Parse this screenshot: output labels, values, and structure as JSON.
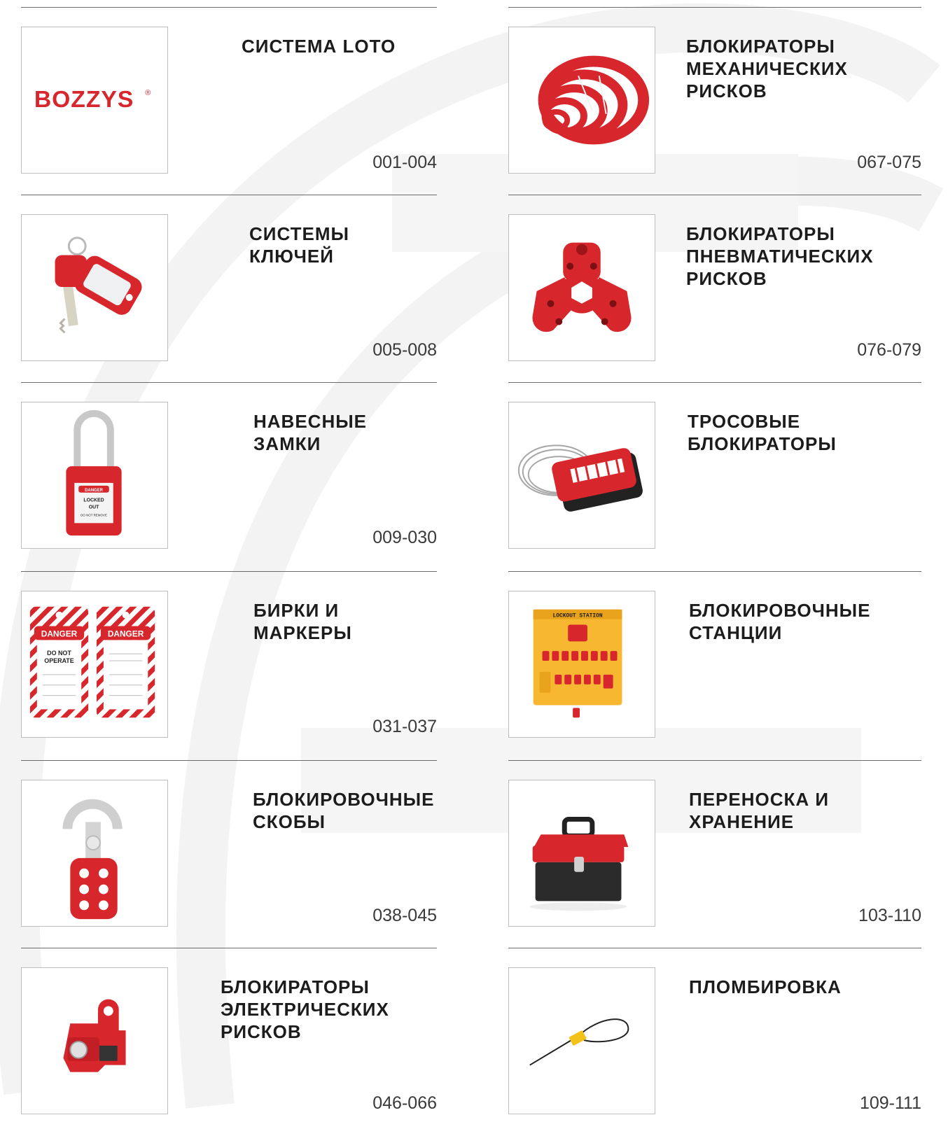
{
  "brand": {
    "logo_text": "BOZZYS",
    "registered_mark": "®"
  },
  "left_column": [
    {
      "title": "СИСТЕМА LOTO",
      "pages": "001-004",
      "icon": "bozzys-logo"
    },
    {
      "title": "СИСТЕМЫ КЛЮЧЕЙ",
      "pages": "005-008",
      "icon": "key-with-tag-icon"
    },
    {
      "title": "НАВЕСНЫЕ ЗАМКИ",
      "pages": "009-030",
      "icon": "padlock-icon"
    },
    {
      "title": "БИРКИ И МАРКЕРЫ",
      "pages": "031-037",
      "icon": "danger-tags-icon"
    },
    {
      "title": "БЛОКИРОВОЧНЫЕ\nСКОБЫ",
      "pages": "038-045",
      "icon": "lockout-hasp-icon"
    },
    {
      "title": "БЛОКИРАТОРЫ\nЭЛЕКТРИЧЕСКИХ\nРИСКОВ",
      "pages": "046-066",
      "icon": "breaker-lockout-icon"
    }
  ],
  "right_column": [
    {
      "title": "БЛОКИРАТОРЫ\nМЕХАНИЧЕСКИХ\nРИСКОВ",
      "pages": "067-075",
      "icon": "valve-lockouts-icon"
    },
    {
      "title": "БЛОКИРАТОРЫ\nПНЕВМАТИЧЕСКИХ\nРИСКОВ",
      "pages": "076-079",
      "icon": "pneumatic-lockout-icon"
    },
    {
      "title": "ТРОСОВЫЕ\nБЛОКИРАТОРЫ",
      "pages": "",
      "icon": "cable-lockout-icon"
    },
    {
      "title": "БЛОКИРОВОЧНЫЕ\nСТАНЦИИ",
      "pages": "",
      "icon": "lockout-station-icon"
    },
    {
      "title": "ПЕРЕНОСКА И\nХРАНЕНИЕ",
      "pages": "103-110",
      "icon": "toolbox-icon"
    },
    {
      "title": "ПЛОМБИРОВКА",
      "pages": "109-111",
      "icon": "cable-seal-icon"
    }
  ],
  "images": {
    "padlock_label": [
      "DANGER",
      "LOCKED",
      "OUT",
      "DO NOT REMOVE"
    ],
    "tag_label": "DANGER",
    "tag_text": [
      "DO NOT",
      "OPERATE"
    ],
    "station_label": "LOCKOUT STATION"
  },
  "colors": {
    "accent": "#d7262c",
    "text": "#1c1c1c",
    "pages_text": "#3a3a3a",
    "rule": "#6a6a6a",
    "frame": "#bdbdbd"
  }
}
